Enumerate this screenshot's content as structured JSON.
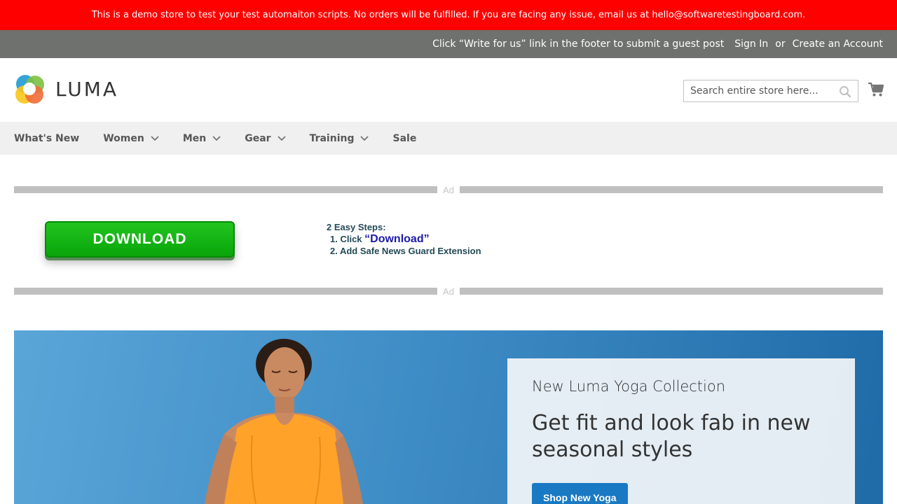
{
  "banner": {
    "text": "This is a demo store to test your test automaiton scripts. No orders will be fulfilled. If you are facing any issue, email us at hello@softwaretestingboard.com."
  },
  "panel": {
    "guest_note": "Click “Write for us” link in the footer to submit a guest post",
    "sign_in": "Sign In",
    "or": "or",
    "create_account": "Create an Account"
  },
  "logo": {
    "text": "LUMA"
  },
  "search": {
    "placeholder": "Search entire store here..."
  },
  "nav": {
    "items": [
      {
        "label": "What's New",
        "has_dropdown": false
      },
      {
        "label": "Women",
        "has_dropdown": true
      },
      {
        "label": "Men",
        "has_dropdown": true
      },
      {
        "label": "Gear",
        "has_dropdown": true
      },
      {
        "label": "Training",
        "has_dropdown": true
      },
      {
        "label": "Sale",
        "has_dropdown": false
      }
    ]
  },
  "ad": {
    "label": "Ad",
    "download_label": "DOWNLOAD",
    "steps_title": "2 Easy Steps:",
    "step1_prefix": "1. Click",
    "step1_link": "“Download”",
    "step2": "2. Add Safe News Guard Extension"
  },
  "hero": {
    "subtitle": "New Luma Yoga Collection",
    "headline": "Get fit and look fab in new seasonal styles",
    "cta": "Shop New Yoga"
  },
  "colors": {
    "banner_bg": "#ff0000",
    "panel_bg": "#6e716e",
    "nav_bg": "#f0f0f0",
    "cta_blue": "#1979c3",
    "download_green": "#13b713"
  }
}
